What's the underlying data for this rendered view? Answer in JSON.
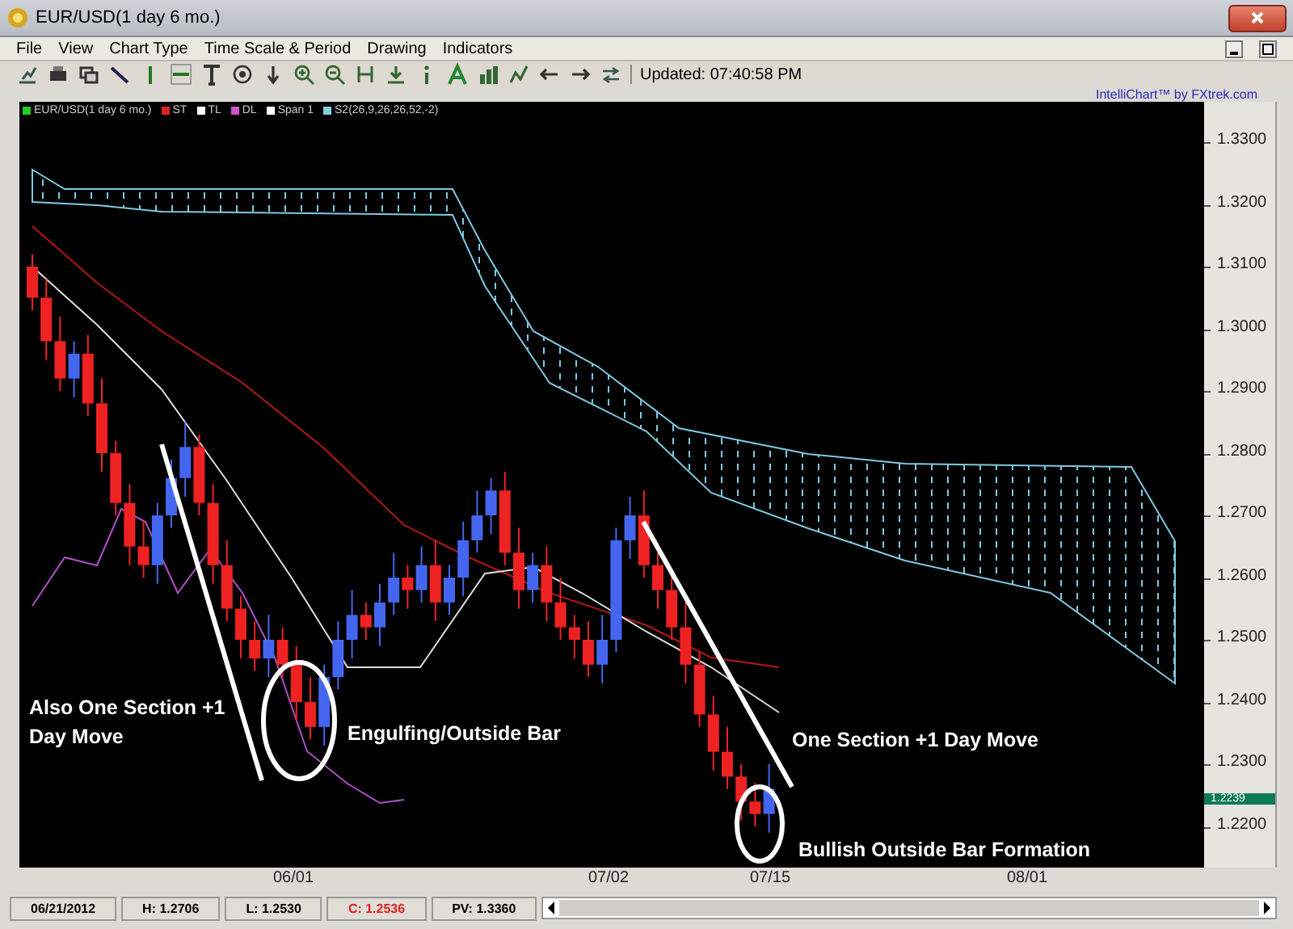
{
  "window": {
    "title": "EUR/USD(1 day  6 mo.)"
  },
  "menu": [
    "File",
    "View",
    "Chart Type",
    "Time Scale & Period",
    "Drawing",
    "Indicators"
  ],
  "toolbar": {
    "updated": "Updated: 07:40:58 PM"
  },
  "credit": "IntelliChart™ by FXtrek.com",
  "legend": [
    {
      "label": "EUR/USD(1 day  6 mo.)",
      "color": "#22cc22"
    },
    {
      "label": "ST",
      "color": "#dd2222"
    },
    {
      "label": "TL",
      "color": "#ffffff"
    },
    {
      "label": "DL",
      "color": "#cc55cc"
    },
    {
      "label": "Span 1",
      "color": "#ffffff"
    },
    {
      "label": "S2(26,9,26,26,52,-2)",
      "color": "#88ccdd"
    }
  ],
  "y_axis": [
    "1.3300",
    "1.3200",
    "1.3100",
    "1.3000",
    "1.2900",
    "1.2800",
    "1.2700",
    "1.2600",
    "1.2500",
    "1.2400",
    "1.2300",
    "1.2200"
  ],
  "price_tag": "1.2239",
  "x_axis": [
    "06/01",
    "07/02",
    "07/15",
    "08/01"
  ],
  "annotations": [
    "Also One Section +1 Day Move",
    "Engulfing/Outside Bar",
    "One Section +1 Day Move",
    "Bullish Outside Bar Formation"
  ],
  "status_bar": [
    {
      "text": "06/21/2012",
      "kind": "plain"
    },
    {
      "text": "H: 1.2706",
      "kind": "plain"
    },
    {
      "text": "L: 1.2530",
      "kind": "plain"
    },
    {
      "text": "C: 1.2536",
      "kind": "alert"
    },
    {
      "text": "PV: 1.3360",
      "kind": "plain"
    }
  ]
}
